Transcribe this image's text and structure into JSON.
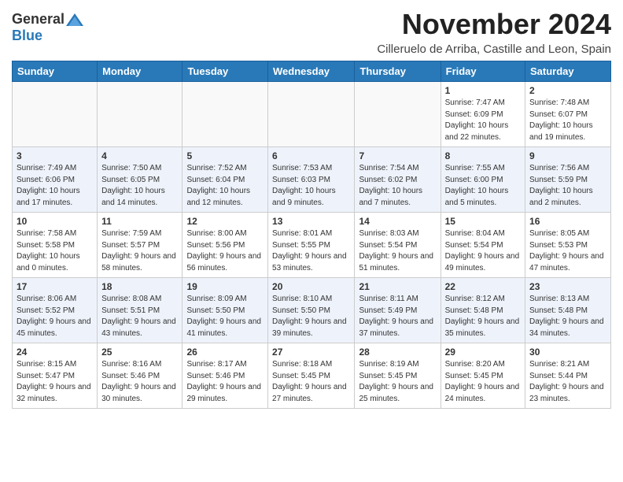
{
  "header": {
    "logo_general": "General",
    "logo_blue": "Blue",
    "month_title": "November 2024",
    "subtitle": "Cilleruelo de Arriba, Castille and Leon, Spain"
  },
  "weekdays": [
    "Sunday",
    "Monday",
    "Tuesday",
    "Wednesday",
    "Thursday",
    "Friday",
    "Saturday"
  ],
  "weeks": [
    [
      {
        "day": "",
        "info": ""
      },
      {
        "day": "",
        "info": ""
      },
      {
        "day": "",
        "info": ""
      },
      {
        "day": "",
        "info": ""
      },
      {
        "day": "",
        "info": ""
      },
      {
        "day": "1",
        "info": "Sunrise: 7:47 AM\nSunset: 6:09 PM\nDaylight: 10 hours and 22 minutes."
      },
      {
        "day": "2",
        "info": "Sunrise: 7:48 AM\nSunset: 6:07 PM\nDaylight: 10 hours and 19 minutes."
      }
    ],
    [
      {
        "day": "3",
        "info": "Sunrise: 7:49 AM\nSunset: 6:06 PM\nDaylight: 10 hours and 17 minutes."
      },
      {
        "day": "4",
        "info": "Sunrise: 7:50 AM\nSunset: 6:05 PM\nDaylight: 10 hours and 14 minutes."
      },
      {
        "day": "5",
        "info": "Sunrise: 7:52 AM\nSunset: 6:04 PM\nDaylight: 10 hours and 12 minutes."
      },
      {
        "day": "6",
        "info": "Sunrise: 7:53 AM\nSunset: 6:03 PM\nDaylight: 10 hours and 9 minutes."
      },
      {
        "day": "7",
        "info": "Sunrise: 7:54 AM\nSunset: 6:02 PM\nDaylight: 10 hours and 7 minutes."
      },
      {
        "day": "8",
        "info": "Sunrise: 7:55 AM\nSunset: 6:00 PM\nDaylight: 10 hours and 5 minutes."
      },
      {
        "day": "9",
        "info": "Sunrise: 7:56 AM\nSunset: 5:59 PM\nDaylight: 10 hours and 2 minutes."
      }
    ],
    [
      {
        "day": "10",
        "info": "Sunrise: 7:58 AM\nSunset: 5:58 PM\nDaylight: 10 hours and 0 minutes."
      },
      {
        "day": "11",
        "info": "Sunrise: 7:59 AM\nSunset: 5:57 PM\nDaylight: 9 hours and 58 minutes."
      },
      {
        "day": "12",
        "info": "Sunrise: 8:00 AM\nSunset: 5:56 PM\nDaylight: 9 hours and 56 minutes."
      },
      {
        "day": "13",
        "info": "Sunrise: 8:01 AM\nSunset: 5:55 PM\nDaylight: 9 hours and 53 minutes."
      },
      {
        "day": "14",
        "info": "Sunrise: 8:03 AM\nSunset: 5:54 PM\nDaylight: 9 hours and 51 minutes."
      },
      {
        "day": "15",
        "info": "Sunrise: 8:04 AM\nSunset: 5:54 PM\nDaylight: 9 hours and 49 minutes."
      },
      {
        "day": "16",
        "info": "Sunrise: 8:05 AM\nSunset: 5:53 PM\nDaylight: 9 hours and 47 minutes."
      }
    ],
    [
      {
        "day": "17",
        "info": "Sunrise: 8:06 AM\nSunset: 5:52 PM\nDaylight: 9 hours and 45 minutes."
      },
      {
        "day": "18",
        "info": "Sunrise: 8:08 AM\nSunset: 5:51 PM\nDaylight: 9 hours and 43 minutes."
      },
      {
        "day": "19",
        "info": "Sunrise: 8:09 AM\nSunset: 5:50 PM\nDaylight: 9 hours and 41 minutes."
      },
      {
        "day": "20",
        "info": "Sunrise: 8:10 AM\nSunset: 5:50 PM\nDaylight: 9 hours and 39 minutes."
      },
      {
        "day": "21",
        "info": "Sunrise: 8:11 AM\nSunset: 5:49 PM\nDaylight: 9 hours and 37 minutes."
      },
      {
        "day": "22",
        "info": "Sunrise: 8:12 AM\nSunset: 5:48 PM\nDaylight: 9 hours and 35 minutes."
      },
      {
        "day": "23",
        "info": "Sunrise: 8:13 AM\nSunset: 5:48 PM\nDaylight: 9 hours and 34 minutes."
      }
    ],
    [
      {
        "day": "24",
        "info": "Sunrise: 8:15 AM\nSunset: 5:47 PM\nDaylight: 9 hours and 32 minutes."
      },
      {
        "day": "25",
        "info": "Sunrise: 8:16 AM\nSunset: 5:46 PM\nDaylight: 9 hours and 30 minutes."
      },
      {
        "day": "26",
        "info": "Sunrise: 8:17 AM\nSunset: 5:46 PM\nDaylight: 9 hours and 29 minutes."
      },
      {
        "day": "27",
        "info": "Sunrise: 8:18 AM\nSunset: 5:45 PM\nDaylight: 9 hours and 27 minutes."
      },
      {
        "day": "28",
        "info": "Sunrise: 8:19 AM\nSunset: 5:45 PM\nDaylight: 9 hours and 25 minutes."
      },
      {
        "day": "29",
        "info": "Sunrise: 8:20 AM\nSunset: 5:45 PM\nDaylight: 9 hours and 24 minutes."
      },
      {
        "day": "30",
        "info": "Sunrise: 8:21 AM\nSunset: 5:44 PM\nDaylight: 9 hours and 23 minutes."
      }
    ]
  ]
}
